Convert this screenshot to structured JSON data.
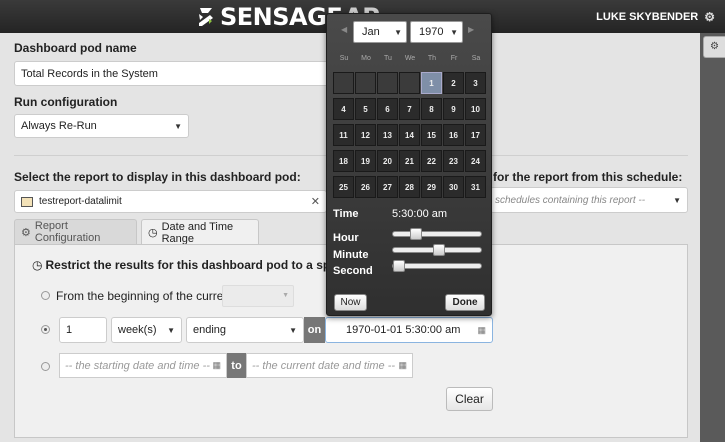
{
  "header": {
    "logo_text": "SENSAGE",
    "logo_suffix": "AP",
    "user_name": "LUKE SKYBENDER",
    "user_icon": "gear-icon"
  },
  "form": {
    "pod_name_label": "Dashboard pod name",
    "pod_name_value": "Total Records in the System",
    "run_config_label": "Run configuration",
    "run_config_value": "Always Re-Run",
    "report_label": "Select the report to display in this dashboard pod:",
    "report_value": "testreport-datalimit",
    "schedule_label": "for the report from this schedule:",
    "schedule_placeholder": "schedules containing this report --"
  },
  "tabs": [
    {
      "label": "Report Configuration",
      "icon": "gear-icon",
      "active": false
    },
    {
      "label": "Date and Time Range",
      "icon": "clock-icon",
      "active": true
    }
  ],
  "range": {
    "restrict_label": "Restrict the results for this dashboard pod to a specif",
    "option1_label": "From the beginning of the current",
    "count_value": "1",
    "unit_value": "week(s)",
    "direction_value": "ending",
    "on_label": "on",
    "datetime_value": "1970-01-01 5:30:00 am",
    "start_placeholder": "-- the starting date and time --",
    "to_label": "to",
    "end_placeholder": "-- the current date and time --",
    "clear_label": "Clear"
  },
  "datepicker": {
    "month": "Jan",
    "year": "1970",
    "weekdays": [
      "Su",
      "Mo",
      "Tu",
      "We",
      "Th",
      "Fr",
      "Sa"
    ],
    "weeks": [
      [
        "",
        "",
        "",
        "",
        "1",
        "2",
        "3"
      ],
      [
        "4",
        "5",
        "6",
        "7",
        "8",
        "9",
        "10"
      ],
      [
        "11",
        "12",
        "13",
        "14",
        "15",
        "16",
        "17"
      ],
      [
        "18",
        "19",
        "20",
        "21",
        "22",
        "23",
        "24"
      ],
      [
        "25",
        "26",
        "27",
        "28",
        "29",
        "30",
        "31"
      ]
    ],
    "selected_day": "1",
    "time_label": "Time",
    "time_value": "5:30:00 am",
    "hour_label": "Hour",
    "minute_label": "Minute",
    "second_label": "Second",
    "hour_value": 5,
    "minute_value": 30,
    "second_value": 0,
    "now_label": "Now",
    "done_label": "Done"
  }
}
